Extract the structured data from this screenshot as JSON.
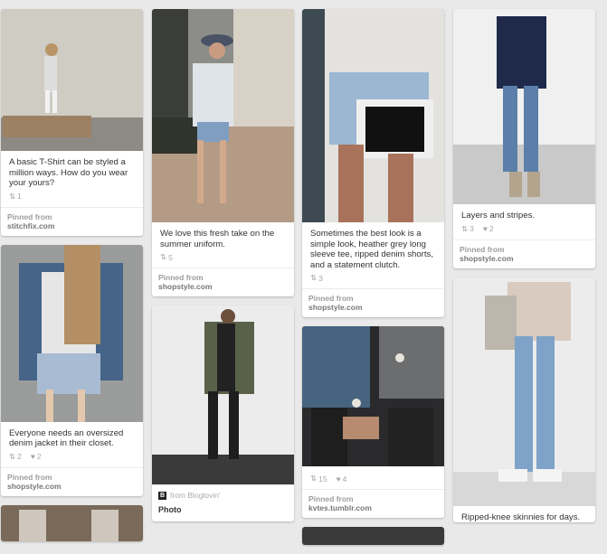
{
  "pins": [
    {
      "desc": "A basic T-Shirt can be styled a million ways. How do you wear your yours?",
      "repins": "1",
      "likes": null,
      "pinned_from": "Pinned from",
      "domain": "stitchfix.com"
    },
    {
      "desc": "We love this fresh take on the summer uniform.",
      "repins": "5",
      "likes": null,
      "pinned_from": "Pinned from",
      "domain": "shopstyle.com"
    },
    {
      "desc": "Sometimes the best look is a simple look, heather grey long sleeve tee, ripped denim shorts, and a statement clutch.",
      "repins": "3",
      "likes": null,
      "pinned_from": "Pinned from",
      "domain": "shopstyle.com"
    },
    {
      "desc": "Layers and stripes.",
      "repins": "3",
      "likes": "2",
      "pinned_from": "Pinned from",
      "domain": "shopstyle.com"
    },
    {
      "desc": "Everyone needs an oversized denim jacket in their closet.",
      "repins": "2",
      "likes": "2",
      "pinned_from": "Pinned from",
      "domain": "shopstyle.com"
    },
    {
      "from_label": "from Bloglovin'",
      "title": "Photo"
    },
    {
      "desc": "",
      "repins": "15",
      "likes": "4",
      "pinned_from": "Pinned from",
      "domain": "kvtes.tumblr.com"
    },
    {
      "desc": "Ripped-knee skinnies for days."
    }
  ],
  "bloglovin_logo": "B"
}
